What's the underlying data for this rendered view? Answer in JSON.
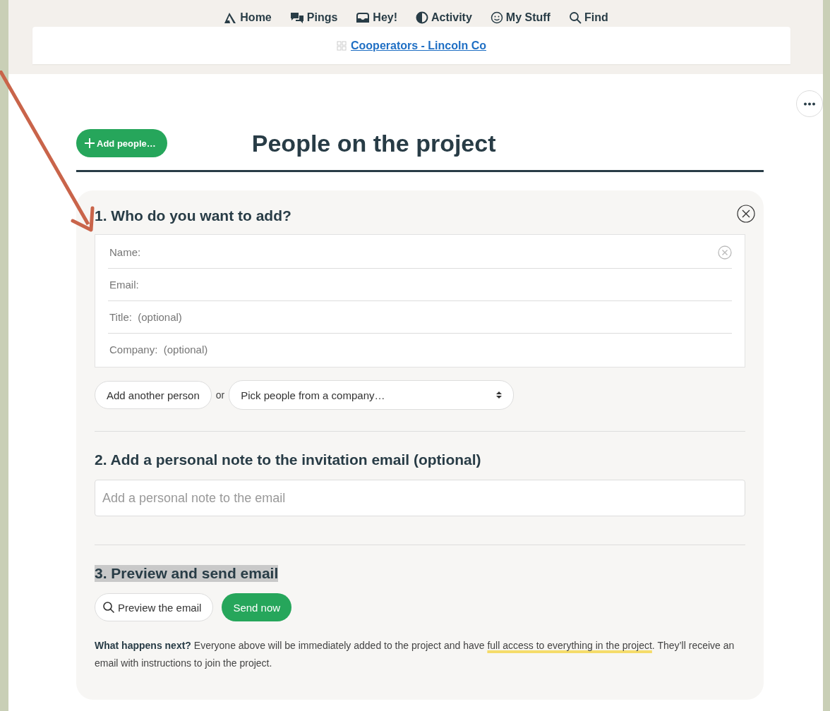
{
  "nav": [
    {
      "kind": "home",
      "label": "Home"
    },
    {
      "kind": "pings",
      "label": "Pings"
    },
    {
      "kind": "hey",
      "label": "Hey!"
    },
    {
      "kind": "activity",
      "label": "Activity"
    },
    {
      "kind": "mystuff",
      "label": "My Stuff"
    },
    {
      "kind": "find",
      "label": "Find"
    }
  ],
  "project_link": "Cooperators - Lincoln Co",
  "add_button": "Add people…",
  "title": "People on the project",
  "section1": {
    "heading": "1. Who do you want to add?",
    "fields": [
      {
        "placeholder": "Name:",
        "clearable": true
      },
      {
        "placeholder": "Email:",
        "clearable": false
      },
      {
        "placeholder": "Title:  (optional)",
        "clearable": false
      },
      {
        "placeholder": "Company:  (optional)",
        "clearable": false
      }
    ],
    "add_another": "Add another person",
    "or": "or",
    "company_select": "Pick people from a company…"
  },
  "section2": {
    "heading": "2. Add a personal note to the invitation email (optional)",
    "placeholder": "Add a personal note to the email"
  },
  "section3": {
    "heading": "3. Preview and send email",
    "highlighted": true,
    "preview_button": "Preview the email",
    "send_button": "Send now"
  },
  "note": {
    "lead": "What happens next?",
    "before": " Everyone above will be immediately added to the project and have ",
    "highlight": "full access to everything in the project",
    "after": ". They’ll receive an email with instructions to join the project."
  }
}
